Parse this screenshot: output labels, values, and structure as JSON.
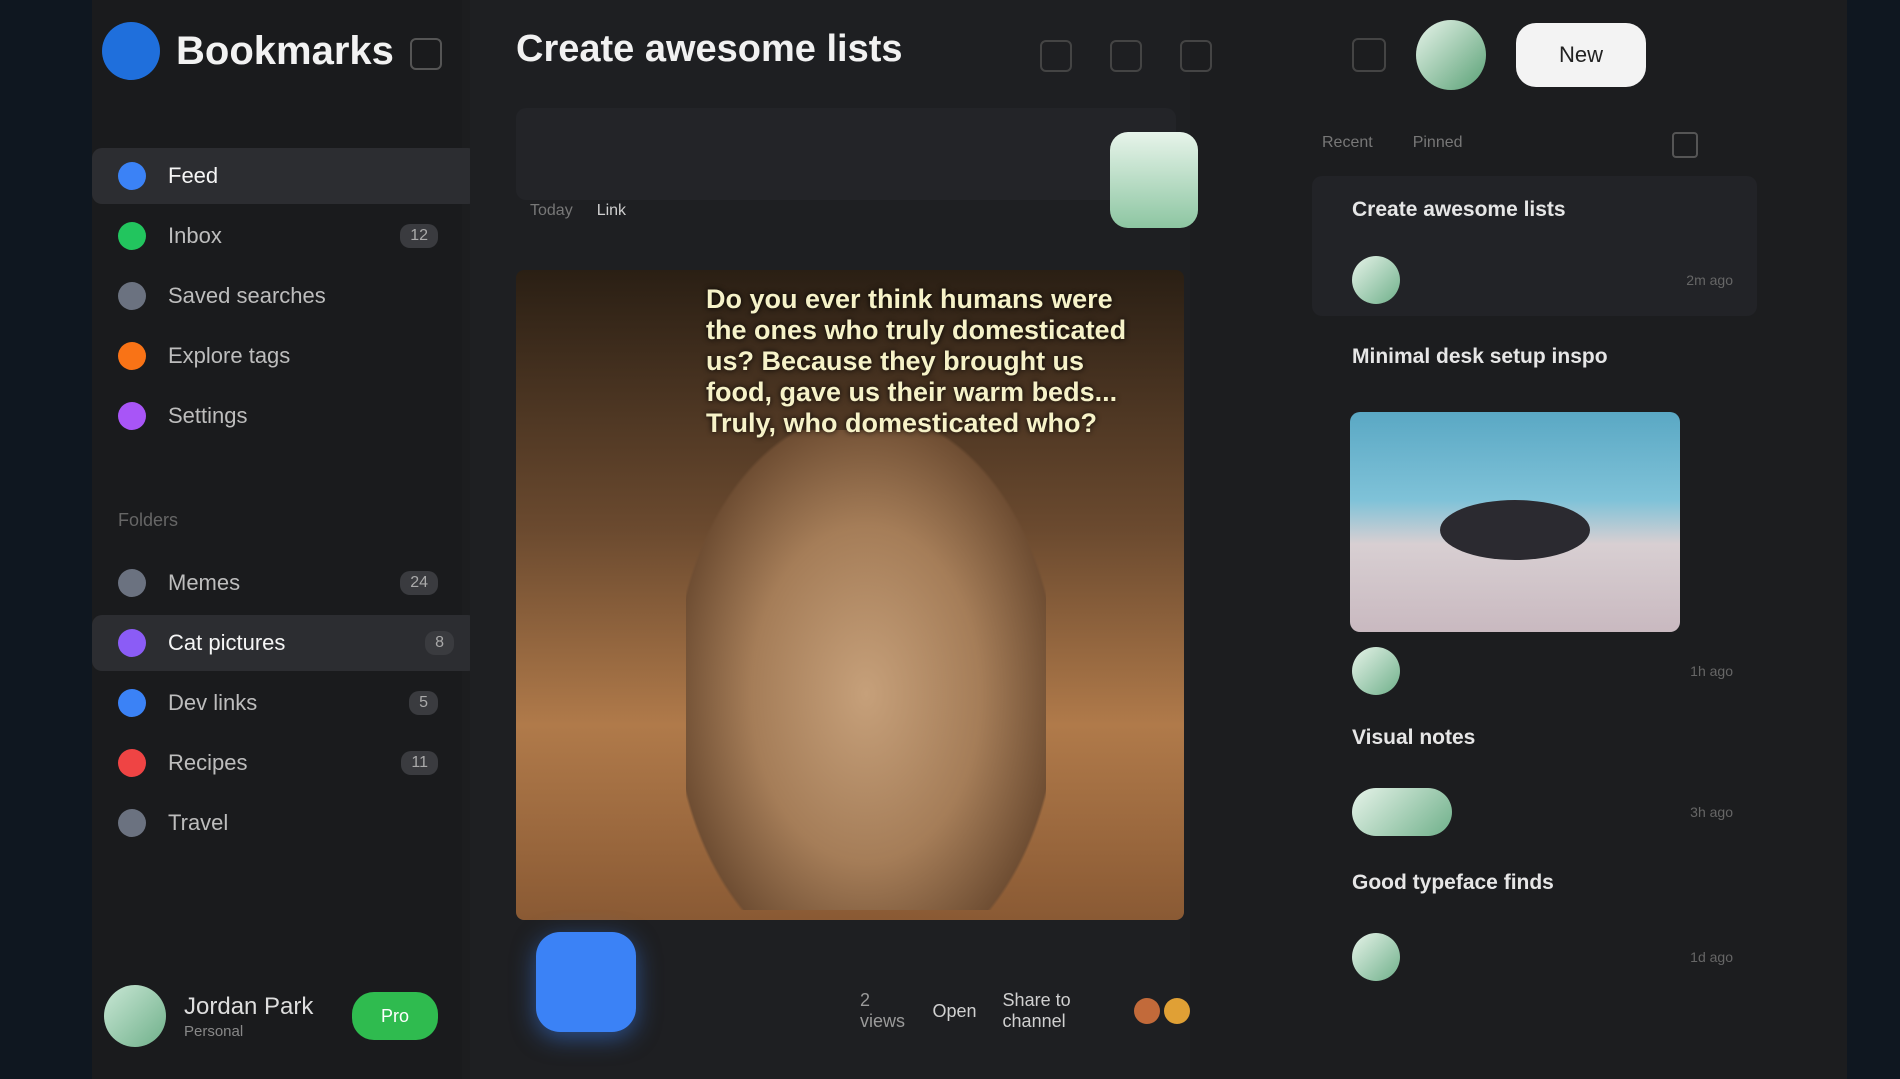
{
  "app": {
    "name": "Bookmarks"
  },
  "sidebar": {
    "items": [
      {
        "label": "Feed",
        "color": "#3b82f6",
        "badge": ""
      },
      {
        "label": "Inbox",
        "color": "#22c55e",
        "badge": "12"
      },
      {
        "label": "Saved searches",
        "color": "#6b7280",
        "badge": ""
      },
      {
        "label": "Explore tags",
        "color": "#f97316",
        "badge": ""
      },
      {
        "label": "Settings",
        "color": "#a855f7",
        "badge": ""
      }
    ],
    "section_label": "Folders",
    "folders": [
      {
        "label": "Memes",
        "color": "#6b7280",
        "badge": "24"
      },
      {
        "label": "Cat pictures",
        "color": "#8b5cf6",
        "badge": "8"
      },
      {
        "label": "Dev links",
        "color": "#3b82f6",
        "badge": "5"
      },
      {
        "label": "Recipes",
        "color": "#ef4444",
        "badge": "11"
      },
      {
        "label": "Travel",
        "color": "#6b7280",
        "badge": ""
      }
    ],
    "profile": {
      "name": "Jordan Park",
      "subtitle": "Personal",
      "action": "Pro"
    }
  },
  "main": {
    "title": "Create awesome lists",
    "meta": {
      "left": "Today",
      "right": "Link"
    },
    "post": {
      "caption": "Do you ever think humans were the ones who truly domesticated us? Because they brought us food, gave us their warm beds... Truly, who domesticated who?",
      "actions": {
        "views": "2 views",
        "open": "Open",
        "share": "Share to channel"
      }
    }
  },
  "right": {
    "new_button": "New",
    "feed_tabs": [
      "Recent",
      "Pinned"
    ],
    "cards": [
      {
        "title": "Create awesome lists",
        "time": "2m ago"
      },
      {
        "title": "Minimal desk setup inspo",
        "time": "1h ago"
      },
      {
        "title": "Visual notes",
        "time": "3h ago"
      },
      {
        "title": "Good typeface finds",
        "time": "1d ago"
      }
    ]
  }
}
